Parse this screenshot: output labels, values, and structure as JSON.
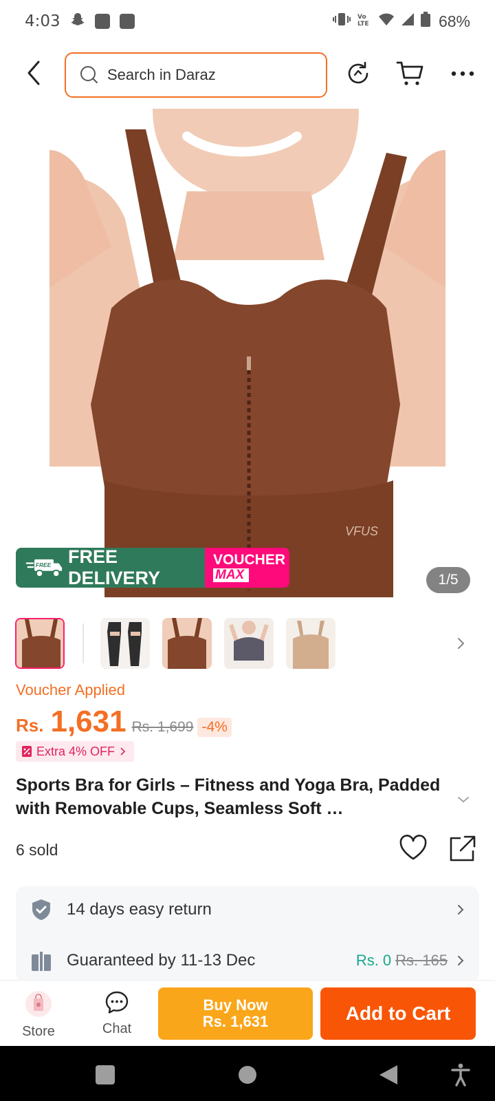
{
  "status_bar": {
    "time": "4:03",
    "battery": "68%",
    "icons": [
      "snapchat-icon",
      "notification-icon",
      "notification-icon",
      "vibrate-icon",
      "volte-icon",
      "wifi-icon",
      "signal-icon",
      "battery-icon"
    ]
  },
  "header": {
    "search_placeholder": "Search in Daraz",
    "icons": [
      "back-arrow-icon",
      "search-icon",
      "refresh-icon",
      "cart-icon",
      "more-icon"
    ]
  },
  "gallery": {
    "banner_free": "FREE",
    "banner_delivery": "FREE DELIVERY",
    "banner_voucher": "VOUCHER",
    "banner_max": "MAX",
    "image_brand": "VFUS",
    "pager": "1/5",
    "thumbnail_count": 5
  },
  "price": {
    "voucher_applied": "Voucher Applied",
    "currency": "Rs.",
    "current": "1,631",
    "original": "Rs. 1,699",
    "discount": "-4%",
    "extra_off": "Extra 4% OFF"
  },
  "product": {
    "title": "Sports Bra for Girls – Fitness and Yoga Bra, Padded with Removable Cups, Seamless Soft …",
    "sold": "6 sold"
  },
  "services": [
    {
      "text": "14 days easy return"
    },
    {
      "text": "Guaranteed by 11-13 Dec",
      "price_now": "Rs. 0",
      "price_was": "Rs. 165"
    }
  ],
  "actions": {
    "store": "Store",
    "chat": "Chat",
    "buy_now": "Buy Now",
    "buy_price": "Rs. 1,631",
    "add_to_cart": "Add to Cart"
  },
  "colors": {
    "accent": "#f36f24",
    "cart_button": "#f85606",
    "buy_button": "#faa61a",
    "free_delivery": "#2f7a5a",
    "voucher_max": "#ff0a7a",
    "shipping_free": "#16a88a"
  }
}
